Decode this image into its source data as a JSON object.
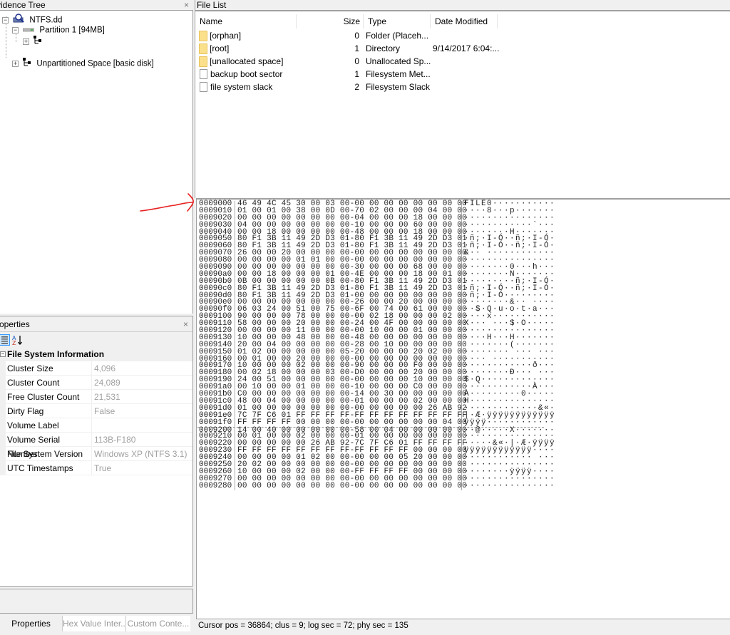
{
  "evidence_tree": {
    "title": "vidence Tree",
    "close": "×",
    "nodes": [
      {
        "label": "NTFS.dd",
        "expander": "−"
      },
      {
        "label": "Partition 1 [94MB]",
        "expander": "−"
      },
      {
        "label": "",
        "expander": "+"
      },
      {
        "label": "Unpartitioned Space [basic disk]",
        "expander": "+"
      }
    ]
  },
  "file_list": {
    "title": "File List",
    "columns": [
      "Name",
      "Size",
      "Type",
      "Date Modified"
    ],
    "rows": [
      {
        "icon": "folder-icon",
        "name": "[orphan]",
        "size": "0",
        "type": "Folder (Placeh...",
        "date": ""
      },
      {
        "icon": "folder-icon",
        "name": "[root]",
        "size": "1",
        "type": "Directory",
        "date": "9/14/2017 6:04:..."
      },
      {
        "icon": "folder-icon",
        "name": "[unallocated space]",
        "size": "0",
        "type": "Unallocated Sp...",
        "date": ""
      },
      {
        "icon": "file-icon",
        "name": "backup boot sector",
        "size": "1",
        "type": "Filesystem Met...",
        "date": ""
      },
      {
        "icon": "file-icon",
        "name": "file system slack",
        "size": "2",
        "type": "Filesystem Slack",
        "date": ""
      }
    ]
  },
  "properties": {
    "title": "roperties",
    "close": "×",
    "section": "File System Information",
    "section_toggle": "−",
    "rows": [
      {
        "name": "Cluster Size",
        "value": "4,096"
      },
      {
        "name": "Cluster Count",
        "value": "24,089"
      },
      {
        "name": "Free Cluster Count",
        "value": "21,531"
      },
      {
        "name": "Dirty Flag",
        "value": "False"
      },
      {
        "name": "Volume Label",
        "value": ""
      },
      {
        "name": "Volume Serial Number",
        "value": "113B-F180"
      },
      {
        "name": "File System Version",
        "value": "Windows XP (NTFS 3.1)"
      },
      {
        "name": "UTC Timestamps",
        "value": "True"
      }
    ]
  },
  "bottom_tabs": [
    "Properties",
    "Hex Value Inter...",
    "Custom Conte..."
  ],
  "hex": {
    "rows": [
      {
        "off": "0009000",
        "bytes": "46 49 4C 45 30 00 03 00-00 00 00 00 00 00 00 00",
        "ascii": "FILE0···········"
      },
      {
        "off": "0009010",
        "bytes": "01 00 01 00 38 00 0D 00-70 02 00 00 00 04 00 00",
        "ascii": "····8···p·······"
      },
      {
        "off": "0009020",
        "bytes": "00 00 00 00 00 00 00 00-04 00 00 00 18 00 00 00",
        "ascii": "················"
      },
      {
        "off": "0009030",
        "bytes": "04 00 00 00 00 00 00 00-10 00 00 00 60 00 00 00",
        "ascii": "············`···"
      },
      {
        "off": "0009040",
        "bytes": "00 00 18 00 00 00 00 00-48 00 00 00 18 00 00 00",
        "ascii": "········H·······"
      },
      {
        "off": "0009050",
        "bytes": "80 F1 3B 11 49 2D D3 01-80 F1 3B 11 49 2D D3 01",
        "ascii": "·ñ;·I-Ó··ñ;·I-Ó·"
      },
      {
        "off": "0009060",
        "bytes": "80 F1 3B 11 49 2D D3 01-80 F1 3B 11 49 2D D3 01",
        "ascii": "·ñ;·I-Ó··ñ;·I-Ó·"
      },
      {
        "off": "0009070",
        "bytes": "26 00 00 20 00 00 00 00-00 00 00 00 00 00 00 00",
        "ascii": "&·· ············"
      },
      {
        "off": "0009080",
        "bytes": "00 00 00 00 01 01 00 00-00 00 00 00 00 00 00 00",
        "ascii": "················"
      },
      {
        "off": "0009090",
        "bytes": "00 00 00 00 00 00 00 00-30 00 00 00 68 00 00 00",
        "ascii": "········0···h···"
      },
      {
        "off": "00090a0",
        "bytes": "00 00 18 00 00 00 01 00-4E 00 00 00 18 00 01 00",
        "ascii": "········N·······"
      },
      {
        "off": "00090b0",
        "bytes": "0B 00 00 00 00 00 0B 00-80 F1 3B 11 49 2D D3 01",
        "ascii": "·········ñ;·I-Ó·"
      },
      {
        "off": "00090c0",
        "bytes": "80 F1 3B 11 49 2D D3 01-80 F1 3B 11 49 2D D3 01",
        "ascii": "·ñ;·I-Ó··ñ;·I-Ó·"
      },
      {
        "off": "00090d0",
        "bytes": "80 F1 3B 11 49 2D D3 01-00 00 00 00 00 00 00 00",
        "ascii": "·ñ;·I-Ó·········"
      },
      {
        "off": "00090e0",
        "bytes": "00 00 00 00 00 00 00 00-26 00 00 20 00 00 00 00",
        "ascii": "········&·· ····"
      },
      {
        "off": "00090f0",
        "bytes": "06 03 24 00 51 00 75 00-6F 00 74 00 61 00 00 00",
        "ascii": "··$·Q·u·o·t·a···"
      },
      {
        "off": "0009100",
        "bytes": "90 00 00 00 78 00 00 00-00 02 18 00 00 00 02 00",
        "ascii": "····x···········"
      },
      {
        "off": "0009110",
        "bytes": "58 00 00 00 20 00 00 00-24 00 4F 00 00 00 00 00",
        "ascii": "X··· ···$·O·····"
      },
      {
        "off": "0009120",
        "bytes": "00 00 00 00 11 00 00 00-00 10 00 00 01 00 00 00",
        "ascii": "················"
      },
      {
        "off": "0009130",
        "bytes": "10 00 00 00 48 00 00 00-48 00 00 00 00 00 00 00",
        "ascii": "····H···H·······"
      },
      {
        "off": "0009140",
        "bytes": "20 00 04 00 00 00 00 00-28 00 10 00 00 00 00 00",
        "ascii": " ·······(·······"
      },
      {
        "off": "0009150",
        "bytes": "01 02 00 00 00 00 00 05-20 00 00 00 20 02 00 00",
        "ascii": "········ ··· ···"
      },
      {
        "off": "0009160",
        "bytes": "00 01 00 00 20 00 00 00-00 00 00 00 00 00 00 00",
        "ascii": "···· ···········"
      },
      {
        "off": "0009170",
        "bytes": "10 00 00 00 02 00 00 00-90 00 00 00 F0 00 00 00",
        "ascii": "············ð···"
      },
      {
        "off": "0009180",
        "bytes": "00 02 18 00 00 00 03 00-D0 00 00 00 20 00 00 00",
        "ascii": "········Ð··· ···"
      },
      {
        "off": "0009190",
        "bytes": "24 00 51 00 00 00 00 00-00 00 00 00 10 00 00 00",
        "ascii": "$·Q·············"
      },
      {
        "off": "00091a0",
        "bytes": "00 10 00 00 01 00 00 00-10 00 00 00 C0 00 00 00",
        "ascii": "············À···"
      },
      {
        "off": "00091b0",
        "bytes": "C0 00 00 00 00 00 00 00-14 00 30 00 00 00 00 00",
        "ascii": "À·········0·····"
      },
      {
        "off": "00091c0",
        "bytes": "48 00 04 00 00 00 00 00-01 00 00 00 02 00 00 00",
        "ascii": "H···············"
      },
      {
        "off": "00091d0",
        "bytes": "01 00 00 00 00 00 00 00-00 00 00 00 00 26 AB 92",
        "ascii": "·············&«·"
      },
      {
        "off": "00091e0",
        "bytes": "7C 7F C6 01 FF FF FF FF-FF FF FF FF FF FF FF FF",
        "ascii": "|·Æ·ÿÿÿÿÿÿÿÿÿÿÿÿ"
      },
      {
        "off": "00091f0",
        "bytes": "FF FF FF FF 00 00 00 00-00 00 00 00 00 00 04 00",
        "ascii": "ÿÿÿÿ············"
      },
      {
        "off": "0009200",
        "bytes": "14 00 40 00 00 00 00 00-58 00 04 00 00 00 00 00",
        "ascii": "··@·····X·······",
        "sector_break": true
      },
      {
        "off": "0009210",
        "bytes": "00 01 00 00 02 00 00 00-01 00 00 00 00 00 00 00",
        "ascii": "················"
      },
      {
        "off": "0009220",
        "bytes": "00 00 00 00 00 26 AB 92-7C 7F C6 01 FF FF FF FF",
        "ascii": "·····&«·|·Æ·ÿÿÿÿ"
      },
      {
        "off": "0009230",
        "bytes": "FF FF FF FF FF FF FF FF-FF FF FF FF 00 00 00 00",
        "ascii": "ÿÿÿÿÿÿÿÿÿÿÿÿ····"
      },
      {
        "off": "0009240",
        "bytes": "00 00 00 00 01 02 00 00-00 00 00 05 20 00 00 00",
        "ascii": "············ ···"
      },
      {
        "off": "0009250",
        "bytes": "20 02 00 00 00 00 00 00-00 00 00 00 00 00 00 00",
        "ascii": " ···············"
      },
      {
        "off": "0009260",
        "bytes": "10 00 00 00 02 00 00 00-FF FF FF FF 00 00 00 00",
        "ascii": "········ÿÿÿÿ····"
      },
      {
        "off": "0009270",
        "bytes": "00 00 00 00 00 00 00 00-00 00 00 00 00 00 00 00",
        "ascii": "················"
      },
      {
        "off": "0009280",
        "bytes": "00 00 00 00 00 00 00 00-00 00 00 00 00 00 00 00",
        "ascii": "················"
      }
    ]
  },
  "status": {
    "text": "Cursor pos = 36864; clus = 9; log sec = 72; phy sec = 135"
  },
  "colors": {
    "annotation_arrow": "#e8201f",
    "folder": "#fbe08c",
    "muted_value": "#a0a0a0"
  }
}
